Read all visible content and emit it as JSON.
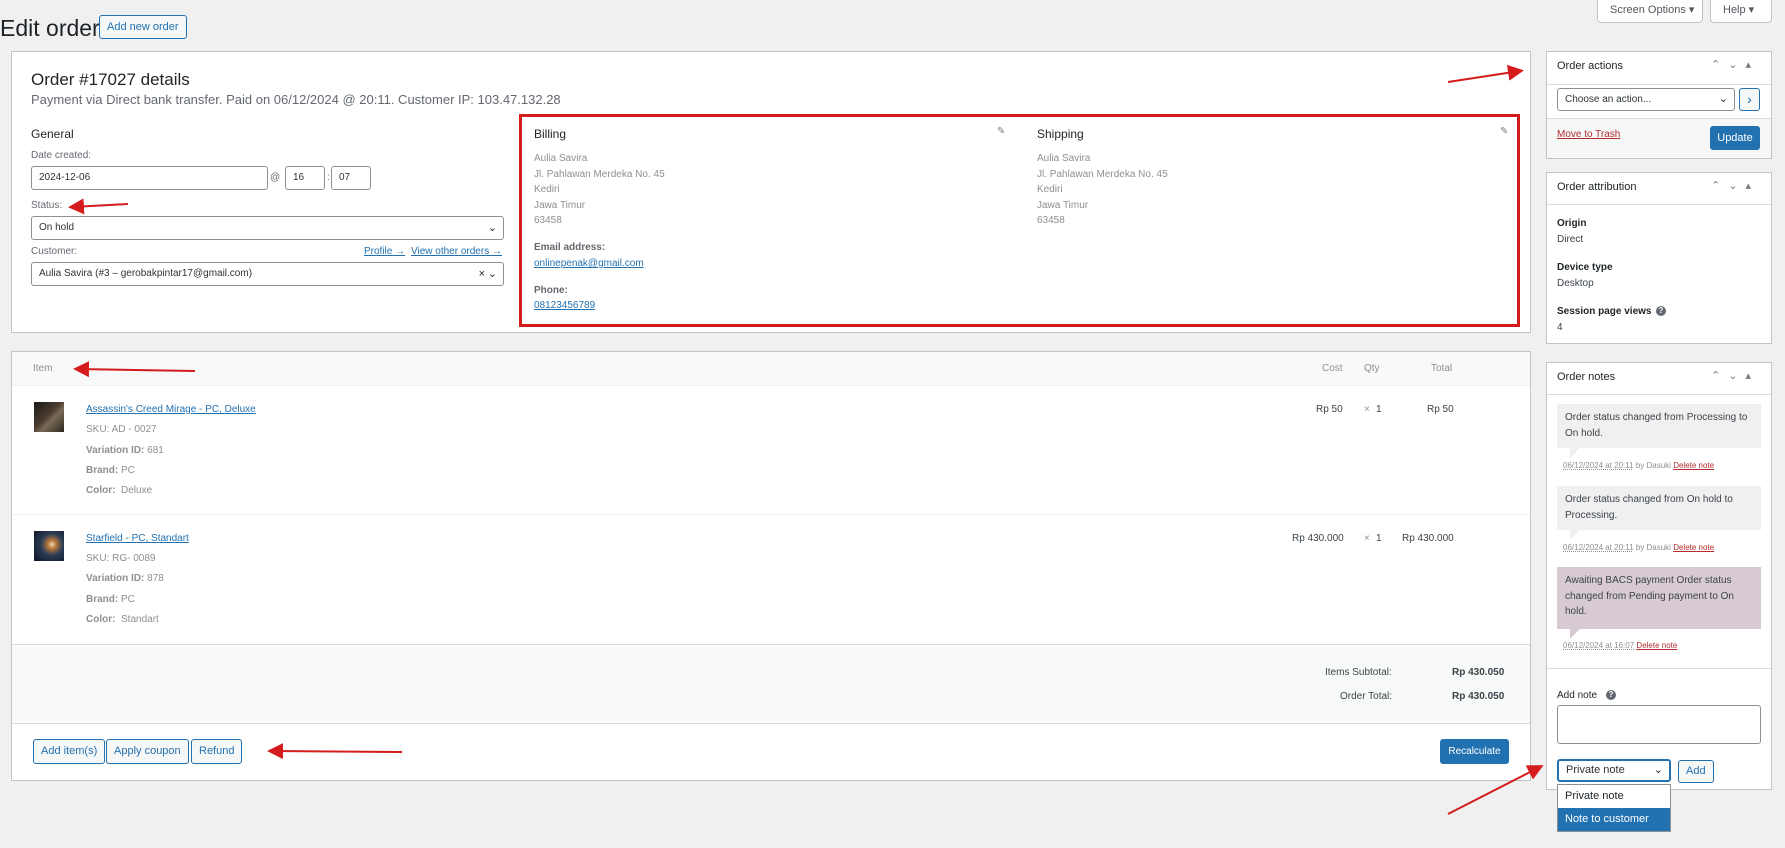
{
  "header": {
    "title": "Edit order",
    "add_new": "Add new order",
    "screen_options": "Screen Options ▾",
    "help": "Help ▾"
  },
  "order": {
    "heading": "Order #17027 details",
    "subheading": "Payment via Direct bank transfer. Paid on 06/12/2024 @ 20:11. Customer IP: 103.47.132.28",
    "general": {
      "title": "General",
      "date_label": "Date created:",
      "date": "2024-12-06",
      "at": "@",
      "hour": "16",
      "colon": ":",
      "minute": "07",
      "status_label": "Status:",
      "status": "On hold",
      "customer_label": "Customer:",
      "profile_link": "Profile →",
      "other_orders_link": "View other orders →",
      "customer": "Aulia Savira (#3 – gerobakpintar17@gmail.com)",
      "clear": "×"
    },
    "billing": {
      "title": "Billing",
      "lines": [
        "Aulia Savira",
        "Jl. Pahlawan Merdeka No. 45",
        "Kediri",
        "Jawa Timur",
        "63458"
      ],
      "email_label": "Email address:",
      "email": "onlinepenak@gmail.com",
      "phone_label": "Phone:",
      "phone": "08123456789"
    },
    "shipping": {
      "title": "Shipping",
      "lines": [
        "Aulia Savira",
        "Jl. Pahlawan Merdeka No. 45",
        "Kediri",
        "Jawa Timur",
        "63458"
      ]
    }
  },
  "items": {
    "headers": {
      "item": "Item",
      "cost": "Cost",
      "qty": "Qty",
      "total": "Total"
    },
    "rows": [
      {
        "name": "Assassin's Creed Mirage - PC, Deluxe",
        "sku_label": "SKU:",
        "sku": "AD - 0027",
        "variation_label": "Variation ID:",
        "variation": "681",
        "brand_label": "Brand:",
        "brand": "PC",
        "color_label": "Color:",
        "color": "Deluxe",
        "cost": "Rp 50",
        "times": "×",
        "qty": "1",
        "total": "Rp 50"
      },
      {
        "name": "Starfield - PC, Standart",
        "sku_label": "SKU:",
        "sku": "RG- 0089",
        "variation_label": "Variation ID:",
        "variation": "878",
        "brand_label": "Brand:",
        "brand": "PC",
        "color_label": "Color:",
        "color": "Standart",
        "cost": "Rp 430.000",
        "times": "×",
        "qty": "1",
        "total": "Rp 430.000"
      }
    ],
    "subtotal_label": "Items Subtotal:",
    "subtotal": "Rp 430.050",
    "order_total_label": "Order Total:",
    "order_total": "Rp 430.050",
    "buttons": {
      "add_items": "Add item(s)",
      "apply_coupon": "Apply coupon",
      "refund": "Refund",
      "recalculate": "Recalculate"
    }
  },
  "sidebar": {
    "order_actions": {
      "title": "Order actions",
      "select": "Choose an action...",
      "go": "›",
      "trash": "Move to Trash",
      "update": "Update"
    },
    "attribution": {
      "title": "Order attribution",
      "origin_label": "Origin",
      "origin": "Direct",
      "device_label": "Device type",
      "device": "Desktop",
      "views_label": "Session page views",
      "views": "4",
      "help": "?"
    },
    "notes": {
      "title": "Order notes",
      "items": [
        {
          "text": "Order status changed from Processing to On hold.",
          "date": "06/12/2024 at 20:11",
          "by": "by Dasuki",
          "delete": "Delete note"
        },
        {
          "text": "Order status changed from On hold to Processing.",
          "date": "06/12/2024 at 20:11",
          "by": "by Dasuki",
          "delete": "Delete note"
        },
        {
          "text": "Awaiting BACS payment Order status changed from Pending payment to On hold.",
          "date": "06/12/2024 at 16:07",
          "by": "",
          "delete": "Delete note"
        }
      ],
      "add_label": "Add note",
      "help": "?",
      "type": "Private note",
      "add_button": "Add",
      "options": [
        "Private note",
        "Note to customer"
      ]
    }
  },
  "controls": {
    "up": "⌃",
    "down": "⌄",
    "collapse": "▴"
  },
  "colors": {
    "accent": "#2271b1",
    "annotation": "#d41c1c",
    "pink_note": "#d7cad2"
  }
}
